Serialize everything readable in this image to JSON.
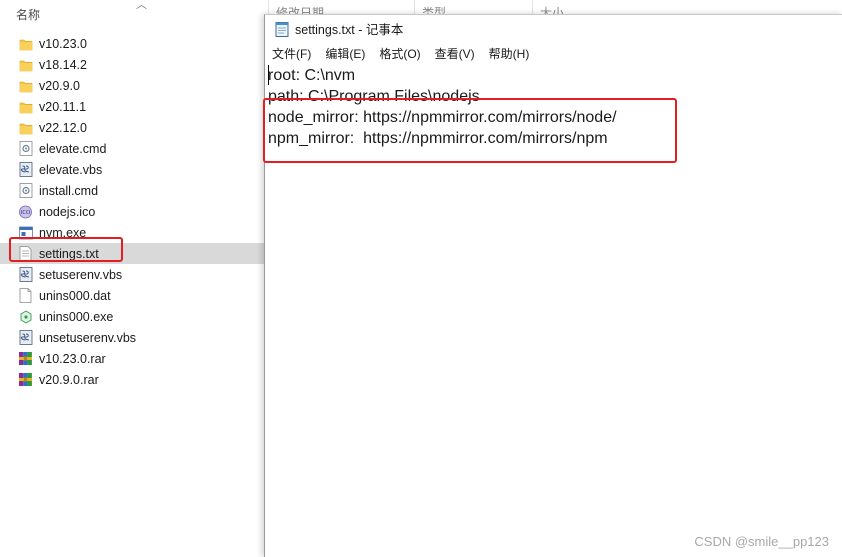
{
  "explorer": {
    "column_name": "名称",
    "column_modified": "修改日期",
    "column_type": "类型",
    "column_size": "大小",
    "files": [
      {
        "name": "v10.23.0",
        "icon": "folder-icon"
      },
      {
        "name": "v18.14.2",
        "icon": "folder-icon"
      },
      {
        "name": "v20.9.0",
        "icon": "folder-icon"
      },
      {
        "name": "v20.11.1",
        "icon": "folder-icon"
      },
      {
        "name": "v22.12.0",
        "icon": "folder-icon"
      },
      {
        "name": "elevate.cmd",
        "icon": "cmd-file-icon"
      },
      {
        "name": "elevate.vbs",
        "icon": "script-file-icon"
      },
      {
        "name": "install.cmd",
        "icon": "cmd-file-icon"
      },
      {
        "name": "nodejs.ico",
        "icon": "ico-file-icon"
      },
      {
        "name": "nvm.exe",
        "icon": "exe-file-icon"
      },
      {
        "name": "settings.txt",
        "icon": "text-file-icon",
        "selected": true
      },
      {
        "name": "setuserenv.vbs",
        "icon": "script-file-icon"
      },
      {
        "name": "unins000.dat",
        "icon": "blank-file-icon"
      },
      {
        "name": "unins000.exe",
        "icon": "installer-icon"
      },
      {
        "name": "unsetuserenv.vbs",
        "icon": "script-file-icon"
      },
      {
        "name": "v10.23.0.rar",
        "icon": "rar-archive-icon"
      },
      {
        "name": "v20.9.0.rar",
        "icon": "rar-archive-icon"
      }
    ]
  },
  "notepad": {
    "title": "settings.txt - 记事本",
    "menu": [
      "文件(F)",
      "编辑(E)",
      "格式(O)",
      "查看(V)",
      "帮助(H)"
    ],
    "lines": [
      "root: C:\\nvm",
      "path: C:\\Program Files\\nodejs",
      "node_mirror: https://npmmirror.com/mirrors/node/",
      "npm_mirror:  https://npmmirror.com/mirrors/npm"
    ]
  },
  "watermark": "CSDN @smile__pp123",
  "colors": {
    "highlight_border": "#e02020",
    "selected_row": "#d9d9d9",
    "folder": "#f5c542"
  }
}
